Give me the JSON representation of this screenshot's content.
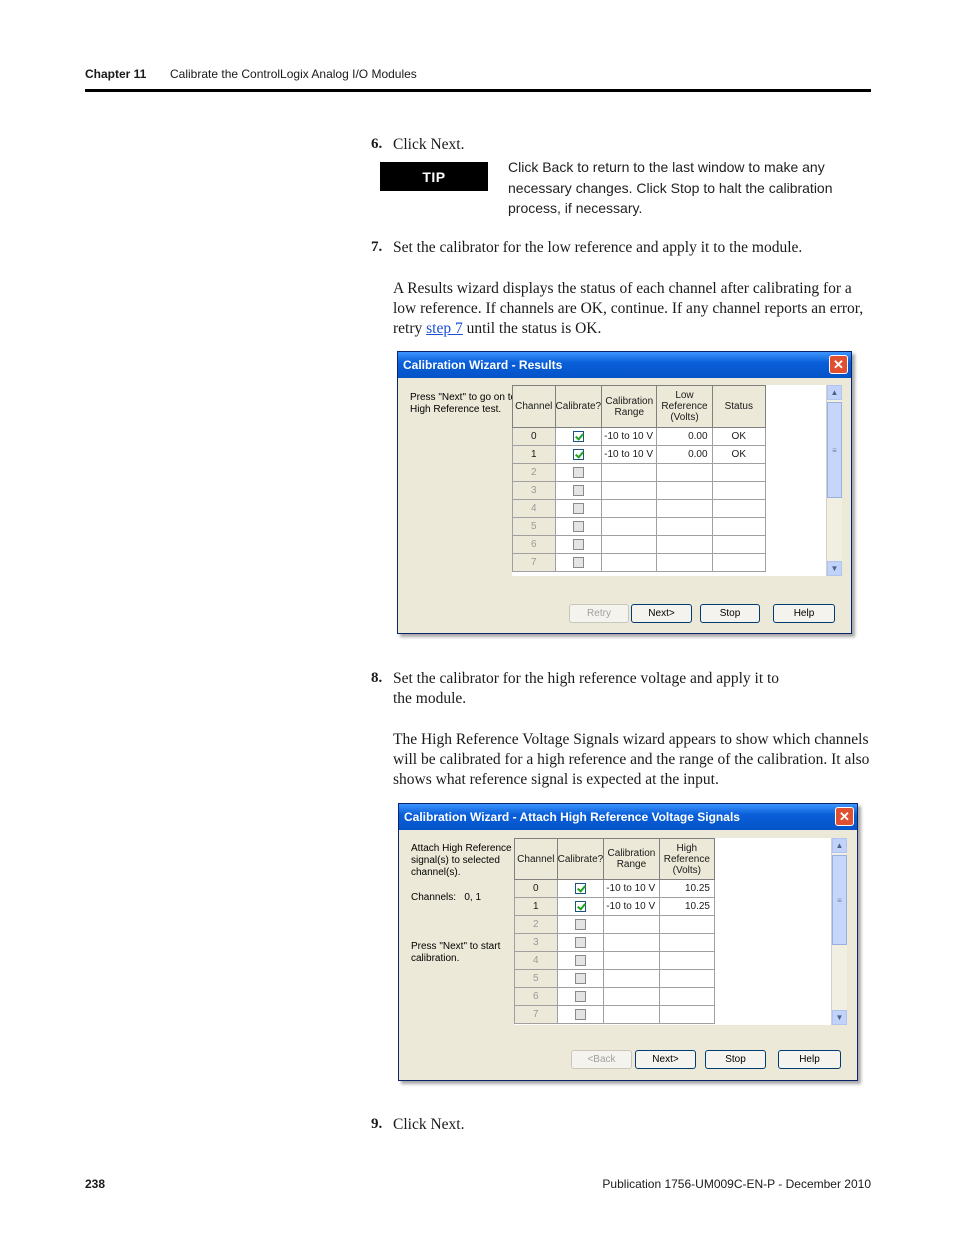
{
  "header": {
    "chapter": "Chapter 11",
    "title": "Calibrate the ControlLogix Analog I/O Modules"
  },
  "steps": {
    "s6": {
      "num": "6.",
      "text": "Click Next."
    },
    "tip": {
      "label": "TIP",
      "text": "Click Back to return to the last window to make any necessary changes. Click Stop to halt the calibration process, if necessary."
    },
    "s7": {
      "num": "7.",
      "text": "Set the calibrator for the low reference and apply it to the module.",
      "para_before": "A Results wizard displays the status of each channel after calibrating for a low reference. If channels are OK, continue. If any channel reports an error, retry ",
      "link": "step 7",
      "para_after": " until the status is OK."
    },
    "s8": {
      "num": "8.",
      "text_line1": "Set the calibrator for the high reference voltage and apply it to",
      "text_line2": "the module.",
      "para": "The High Reference Voltage Signals wizard appears to show which channels will be calibrated for a high reference and the range of the calibration. It also shows what reference signal is expected at the input."
    },
    "s9": {
      "num": "9.",
      "text": "Click Next."
    }
  },
  "dialog1": {
    "title": "Calibration Wizard - Results",
    "close": "✕",
    "instruction_line1": "Press \"Next\" to go on to",
    "instruction_line2": "High Reference test.",
    "headers": {
      "channel": "Channel",
      "calibrate": "Calibrate?",
      "range_1": "Calibration",
      "range_2": "Range",
      "low_1": "Low",
      "low_2": "Reference",
      "low_3": "(Volts)",
      "status": "Status"
    },
    "rows": [
      {
        "ch": "0",
        "checked": true,
        "range": "-10 to 10 V",
        "value": "0.00",
        "status": "OK"
      },
      {
        "ch": "1",
        "checked": true,
        "range": "-10 to 10 V",
        "value": "0.00",
        "status": "OK"
      },
      {
        "ch": "2",
        "checked": false,
        "range": "",
        "value": "",
        "status": ""
      },
      {
        "ch": "3",
        "checked": false,
        "range": "",
        "value": "",
        "status": ""
      },
      {
        "ch": "4",
        "checked": false,
        "range": "",
        "value": "",
        "status": ""
      },
      {
        "ch": "5",
        "checked": false,
        "range": "",
        "value": "",
        "status": ""
      },
      {
        "ch": "6",
        "checked": false,
        "range": "",
        "value": "",
        "status": ""
      },
      {
        "ch": "7",
        "checked": false,
        "range": "",
        "value": "",
        "status": ""
      }
    ],
    "buttons": {
      "retry": "Retry",
      "next": "Next>",
      "stop": "Stop",
      "help": "Help"
    }
  },
  "dialog2": {
    "title": "Calibration Wizard - Attach High Reference Voltage Signals",
    "close": "✕",
    "instruction_line1": "Attach High Reference",
    "instruction_line2": "signal(s) to selected",
    "instruction_line3": "channel(s).",
    "channels_label": "Channels:",
    "channels_value": "0, 1",
    "start_line1": "Press \"Next\" to start",
    "start_line2": "calibration.",
    "headers": {
      "channel": "Channel",
      "calibrate": "Calibrate?",
      "range_1": "Calibration",
      "range_2": "Range",
      "high_1": "High",
      "high_2": "Reference",
      "high_3": "(Volts)"
    },
    "rows": [
      {
        "ch": "0",
        "checked": true,
        "range": "-10 to 10 V",
        "value": "10.25"
      },
      {
        "ch": "1",
        "checked": true,
        "range": "-10 to 10 V",
        "value": "10.25"
      },
      {
        "ch": "2",
        "checked": false,
        "range": "",
        "value": ""
      },
      {
        "ch": "3",
        "checked": false,
        "range": "",
        "value": ""
      },
      {
        "ch": "4",
        "checked": false,
        "range": "",
        "value": ""
      },
      {
        "ch": "5",
        "checked": false,
        "range": "",
        "value": ""
      },
      {
        "ch": "6",
        "checked": false,
        "range": "",
        "value": ""
      },
      {
        "ch": "7",
        "checked": false,
        "range": "",
        "value": ""
      }
    ],
    "buttons": {
      "back": "<Back",
      "next": "Next>",
      "stop": "Stop",
      "help": "Help"
    }
  },
  "footer": {
    "page": "238",
    "publication": "Publication 1756-UM009C-EN-P - December 2010"
  },
  "colors": {
    "titlebar": "#0a5fd8",
    "tip_bg": "#000000",
    "link": "#1a4fd6"
  }
}
